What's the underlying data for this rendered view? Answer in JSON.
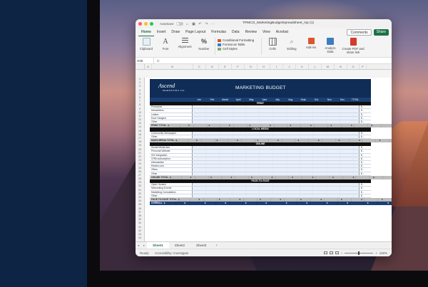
{
  "window": {
    "doc_title": "TPMCO_MarketingBudgetSpreadsheet_mp (1)",
    "autosave_label": "AutoSave"
  },
  "ribbon_tabs": [
    {
      "label": "Home",
      "active": true
    },
    {
      "label": "Insert"
    },
    {
      "label": "Draw"
    },
    {
      "label": "Page Layout"
    },
    {
      "label": "Formulas"
    },
    {
      "label": "Data"
    },
    {
      "label": "Review"
    },
    {
      "label": "View"
    },
    {
      "label": "Acrobat"
    }
  ],
  "comments_label": "Comments",
  "share_label": "Share",
  "ribbon": {
    "clipboard": "Clipboard",
    "font": "Font",
    "alignment": "Alignment",
    "number": "Number",
    "conditional_formatting": "Conditional Formatting",
    "format_as_table": "Format as Table",
    "cell_styles": "Cell Styles",
    "cells": "Cells",
    "editing": "Editing",
    "addins": "Add-ins",
    "analyze": "Analyze Data",
    "create_pdf": "Create PDF and share link"
  },
  "formula_bar": {
    "name_box": "H35",
    "fx": "fx",
    "value": ""
  },
  "columns": [
    "A",
    "B",
    "C",
    "D",
    "E",
    "F",
    "G",
    "H",
    "I",
    "J",
    "K",
    "L",
    "M",
    "N",
    "O",
    "P"
  ],
  "row_numbers": [
    "1",
    "2",
    "3",
    "4",
    "5",
    "6",
    "7",
    "8",
    "9",
    "10",
    "11",
    "12",
    "13",
    "14",
    "15",
    "16",
    "17",
    "18",
    "19",
    "20",
    "21",
    "22",
    "23",
    "24",
    "25",
    "26",
    "27",
    "28",
    "29",
    "30",
    "31",
    "32",
    "33",
    "34",
    "35",
    "36",
    "37",
    "38",
    "39",
    "40",
    "41",
    "42",
    "43",
    "44"
  ],
  "budget": {
    "logo": "Ascend",
    "logo_sub": "MARKETING CO.",
    "title": "MARKETING BUDGET",
    "months": [
      "Jan",
      "Feb",
      "March",
      "April",
      "May",
      "June",
      "July",
      "Aug",
      "Sept.",
      "Oct.",
      "Nov.",
      "Dec."
    ],
    "total_label": "TOTAL",
    "sections": [
      {
        "name": "PRINT",
        "items": [
          "Postcards",
          "Newsletters",
          "Letters",
          "Door Hangers",
          "Other"
        ],
        "total": "PRINT TOTAL"
      },
      {
        "name": "LOCAL MEDIA",
        "items": [
          "Community Newspaper",
          "Other"
        ],
        "total": "MASS MEDIA TOTAL"
      },
      {
        "name": "ONLINE",
        "items": [
          "Social Media Ads",
          "Personal Website",
          "IDX integration",
          "CRM subscription",
          "eNewsletter",
          "Realtor.com",
          "Zillow",
          "Other"
        ],
        "total": "ONLINE TOTAL"
      },
      {
        "name": "FACE-TO-FACE",
        "items": [
          "Open Houses",
          "Networking Events",
          "Marketing Consultation",
          "Other"
        ],
        "total": "FACE-TO-FACE TOTAL"
      }
    ],
    "overall_label": "OVERALL TOTALS",
    "dollar_cell": "$ -"
  },
  "sheet_tabs": [
    "Sheet1",
    "Sheet2",
    "Sheet3"
  ],
  "status": {
    "ready": "Ready",
    "accessibility": "Accessibility: Investigate",
    "zoom": "100%"
  },
  "colors": {
    "accent": "#1e7145",
    "banner": "#0f2d57",
    "navy_panel": "#0d2444"
  }
}
